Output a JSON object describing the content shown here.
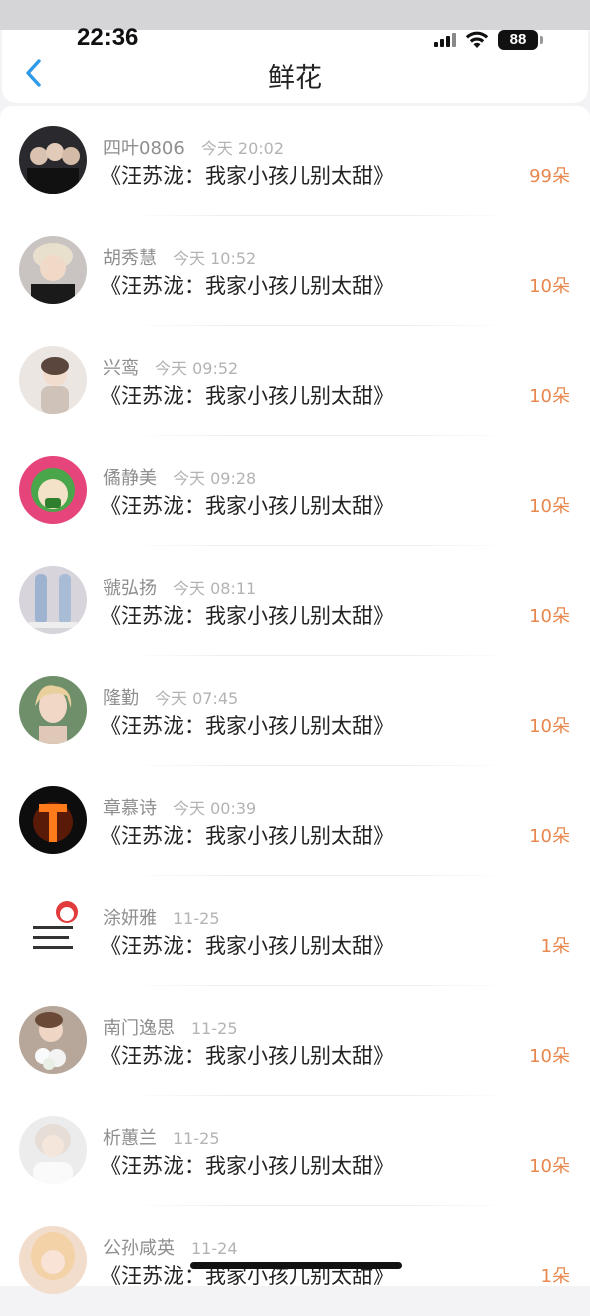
{
  "status_bar": {
    "time": "22:36",
    "battery": "88"
  },
  "header": {
    "title": "鲜花",
    "back_icon": "chevron-left-icon"
  },
  "items": [
    {
      "name": "四叶0806",
      "time": "今天 20:02",
      "title": "《汪苏泷：我家小孩儿别太甜》",
      "count": "99朵"
    },
    {
      "name": "胡秀慧",
      "time": "今天 10:52",
      "title": "《汪苏泷：我家小孩儿别太甜》",
      "count": "10朵"
    },
    {
      "name": "兴鸾",
      "time": "今天 09:52",
      "title": "《汪苏泷：我家小孩儿别太甜》",
      "count": "10朵"
    },
    {
      "name": "僪静美",
      "time": "今天 09:28",
      "title": "《汪苏泷：我家小孩儿别太甜》",
      "count": "10朵"
    },
    {
      "name": "虢弘扬",
      "time": "今天 08:11",
      "title": "《汪苏泷：我家小孩儿别太甜》",
      "count": "10朵"
    },
    {
      "name": "隆勤",
      "time": "今天 07:45",
      "title": "《汪苏泷：我家小孩儿别太甜》",
      "count": "10朵"
    },
    {
      "name": "章慕诗",
      "time": "今天 00:39",
      "title": "《汪苏泷：我家小孩儿别太甜》",
      "count": "10朵"
    },
    {
      "name": "涂妍雅",
      "time": "11-25",
      "title": "《汪苏泷：我家小孩儿别太甜》",
      "count": "1朵"
    },
    {
      "name": "南门逸思",
      "time": "11-25",
      "title": "《汪苏泷：我家小孩儿别太甜》",
      "count": "10朵"
    },
    {
      "name": "析蕙兰",
      "time": "11-25",
      "title": "《汪苏泷：我家小孩儿别太甜》",
      "count": "10朵"
    },
    {
      "name": "公孙咸英",
      "time": "11-24",
      "title": "《汪苏泷：我家小孩儿别太甜》",
      "count": "1朵"
    }
  ],
  "colors": {
    "accent_blue": "#2f9be8",
    "flower_orange": "#e8884e",
    "title_text": "#222222",
    "meta_text": "#999999"
  }
}
